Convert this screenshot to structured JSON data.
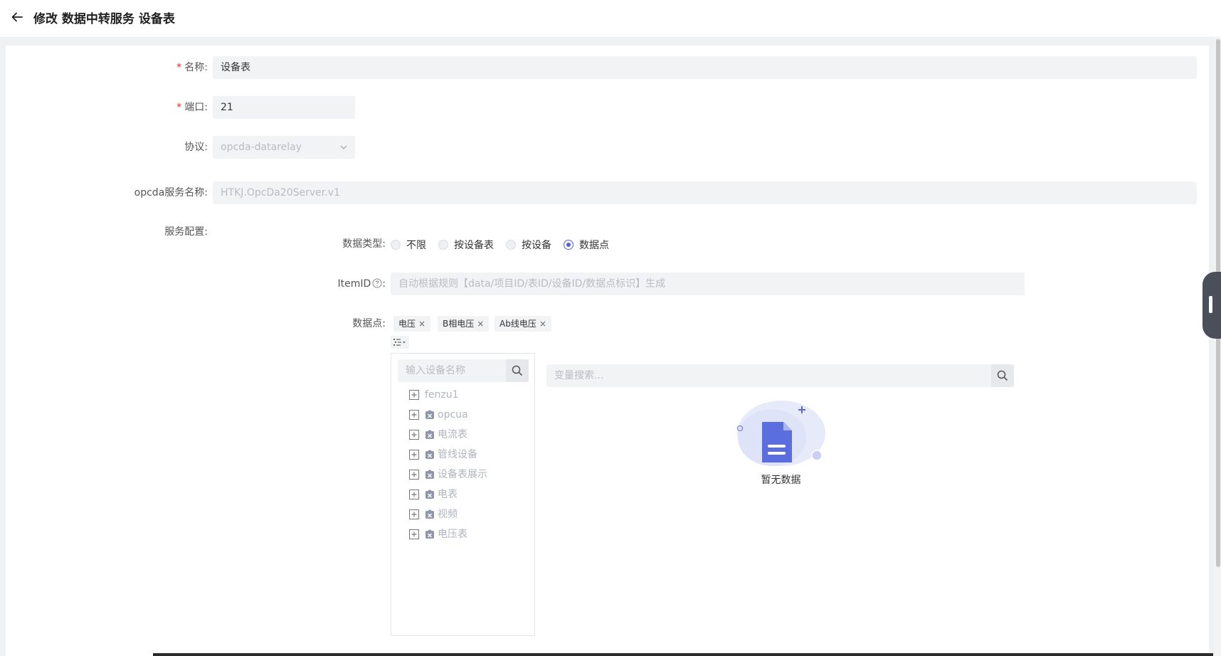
{
  "header": {
    "title": "修改 数据中转服务 设备表"
  },
  "form": {
    "name_label": "名称:",
    "name_value": "设备表",
    "port_label": "端口:",
    "port_value": "21",
    "protocol_label": "协议:",
    "protocol_value": "opcda-datarelay",
    "server_name_label": "opcda服务名称:",
    "server_name_value": "HTKJ.OpcDa20Server.v1",
    "service_config_label": "服务配置:",
    "data_type_label": "数据类型:",
    "data_type_options": [
      "不限",
      "按设备表",
      "按设备",
      "数据点"
    ],
    "data_type_selected": "数据点",
    "itemid_label": "ItemID",
    "itemid_colon": ":",
    "itemid_placeholder": "自动根据规则【data/项目ID/表ID/设备ID/数据点标识】生成",
    "datapoints_label": "数据点:",
    "datapoint_tags": [
      "电压",
      "B相电压",
      "Ab线电压"
    ]
  },
  "tree": {
    "search_placeholder": "输入设备名称",
    "nodes": [
      {
        "label": "fenzu1",
        "type": "group"
      },
      {
        "label": "opcua",
        "type": "device-table"
      },
      {
        "label": "电流表",
        "type": "device-table"
      },
      {
        "label": "管线设备",
        "type": "device-table"
      },
      {
        "label": "设备表展示",
        "type": "device-table"
      },
      {
        "label": "电表",
        "type": "device-table"
      },
      {
        "label": "视频",
        "type": "device-table"
      },
      {
        "label": "电压表",
        "type": "device-table"
      }
    ]
  },
  "variables": {
    "search_placeholder": "变量搜索...",
    "empty_text": "暂无数据"
  },
  "colors": {
    "primary": "#4e63d9",
    "required": "#f5222d",
    "input_bg": "#f2f3f5"
  }
}
